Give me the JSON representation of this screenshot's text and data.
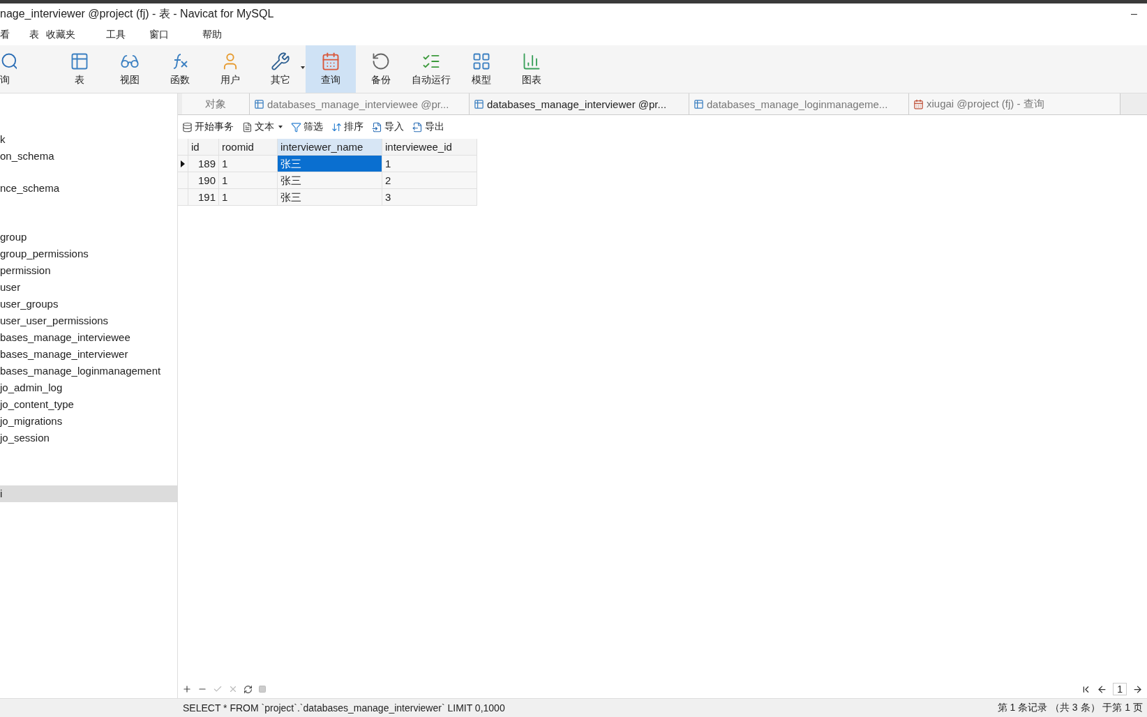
{
  "window": {
    "title": "nage_interviewer @project (fj) - 表 - Navicat for MySQL",
    "minimize": "–"
  },
  "menu": [
    "看",
    "表",
    "收藏夹",
    "工具",
    "窗口",
    "帮助"
  ],
  "toolbar": [
    {
      "label": "询",
      "selected": false,
      "dropdown": false
    },
    {
      "label": "表",
      "selected": false,
      "dropdown": false
    },
    {
      "label": "视图",
      "selected": false,
      "dropdown": false
    },
    {
      "label": "函数",
      "selected": false,
      "dropdown": false
    },
    {
      "label": "用户",
      "selected": false,
      "dropdown": false
    },
    {
      "label": "其它",
      "selected": false,
      "dropdown": true
    },
    {
      "label": "查询",
      "selected": true,
      "dropdown": false
    },
    {
      "label": "备份",
      "selected": false,
      "dropdown": false
    },
    {
      "label": "自动运行",
      "selected": false,
      "dropdown": false
    },
    {
      "label": "模型",
      "selected": false,
      "dropdown": false
    },
    {
      "label": "图表",
      "selected": false,
      "dropdown": false
    }
  ],
  "sidebar": {
    "sections": [
      {
        "items": [
          {
            "label": "k",
            "selected": false
          },
          {
            "label": "on_schema",
            "selected": false
          }
        ]
      },
      {
        "items": [
          {
            "label": "nce_schema",
            "selected": false
          }
        ]
      },
      {
        "items": [
          {
            "label": "group",
            "selected": false
          },
          {
            "label": "group_permissions",
            "selected": false
          },
          {
            "label": "permission",
            "selected": false
          },
          {
            "label": "user",
            "selected": false
          },
          {
            "label": "user_groups",
            "selected": false
          },
          {
            "label": "user_user_permissions",
            "selected": false
          },
          {
            "label": "bases_manage_interviewee",
            "selected": false
          },
          {
            "label": "bases_manage_interviewer",
            "selected": false
          },
          {
            "label": "bases_manage_loginmanagement",
            "selected": false
          },
          {
            "label": "jo_admin_log",
            "selected": false
          },
          {
            "label": "jo_content_type",
            "selected": false
          },
          {
            "label": "jo_migrations",
            "selected": false
          },
          {
            "label": "jo_session",
            "selected": false
          }
        ]
      },
      {
        "items": [
          {
            "label": "i",
            "selected": true
          }
        ]
      }
    ]
  },
  "tabs": [
    {
      "label": "对象",
      "kind": "objects",
      "selected": false
    },
    {
      "label": "databases_manage_interviewee @pr...",
      "kind": "table",
      "selected": false
    },
    {
      "label": "databases_manage_interviewer @pr...",
      "kind": "table",
      "selected": true
    },
    {
      "label": "databases_manage_loginmanageme...",
      "kind": "table",
      "selected": false
    },
    {
      "label": "xiugai @project (fj) - 查询",
      "kind": "query",
      "selected": false
    }
  ],
  "grid_toolbar": [
    {
      "label": "开始事务",
      "dropdown": false
    },
    {
      "label": "文本",
      "dropdown": true
    },
    {
      "label": "筛选",
      "dropdown": false
    },
    {
      "label": "排序",
      "dropdown": false
    },
    {
      "label": "导入",
      "dropdown": false
    },
    {
      "label": "导出",
      "dropdown": false
    }
  ],
  "table": {
    "columns": [
      {
        "label": "id",
        "selected": false
      },
      {
        "label": "roomid",
        "selected": false
      },
      {
        "label": "interviewer_name",
        "selected": true
      },
      {
        "label": "interviewee_id",
        "selected": false
      }
    ],
    "rows": [
      {
        "current": true,
        "cells": [
          {
            "text": "189",
            "selected": false
          },
          {
            "text": "1",
            "selected": false
          },
          {
            "text": "张三",
            "selected": true
          },
          {
            "text": "1",
            "selected": false
          }
        ]
      },
      {
        "current": false,
        "cells": [
          {
            "text": "190",
            "selected": false
          },
          {
            "text": "1",
            "selected": false
          },
          {
            "text": "张三",
            "selected": false
          },
          {
            "text": "2",
            "selected": false
          }
        ]
      },
      {
        "current": false,
        "cells": [
          {
            "text": "191",
            "selected": false
          },
          {
            "text": "1",
            "selected": false
          },
          {
            "text": "张三",
            "selected": false
          },
          {
            "text": "3",
            "selected": false
          }
        ]
      }
    ]
  },
  "pager": {
    "page": "1"
  },
  "status_bar": {
    "sql": "SELECT * FROM `project`.`databases_manage_interviewer` LIMIT 0,1000",
    "info": "第 1 条记录 （共 3 条） 于第 1 页"
  }
}
